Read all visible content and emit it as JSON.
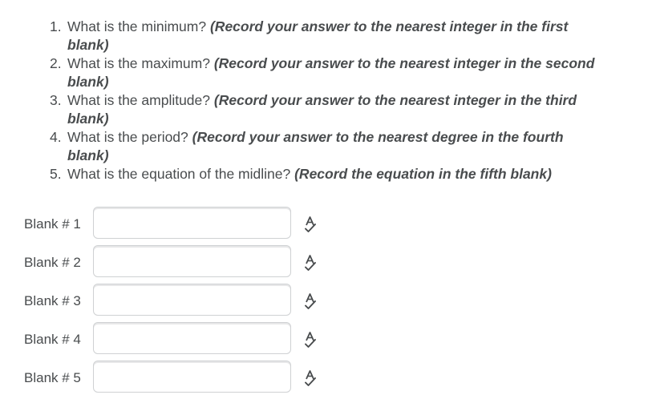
{
  "questions": [
    {
      "number": "1.",
      "text": "What is the minimum?",
      "note": "(Record your answer to the nearest integer in the first blank)"
    },
    {
      "number": "2.",
      "text": "What is the maximum?",
      "note": "(Record your answer to the nearest integer in the second blank)"
    },
    {
      "number": "3.",
      "text": "What is the amplitude?",
      "note": "(Record your answer to the nearest integer in the third blank)"
    },
    {
      "number": "4.",
      "text": "What is the period?",
      "note": "(Record your answer to the nearest degree in the fourth blank)"
    },
    {
      "number": "5.",
      "text": "What is the equation of the midline?",
      "note": "(Record the equation in the fifth blank)"
    }
  ],
  "blanks": [
    {
      "label": "Blank # 1",
      "value": "",
      "icon": "spellcheck-icon"
    },
    {
      "label": "Blank # 2",
      "value": "",
      "icon": "spellcheck-icon"
    },
    {
      "label": "Blank # 3",
      "value": "",
      "icon": "spellcheck-icon"
    },
    {
      "label": "Blank # 4",
      "value": "",
      "icon": "spellcheck-icon"
    },
    {
      "label": "Blank # 5",
      "value": "",
      "icon": "spellcheck-icon"
    }
  ],
  "colors": {
    "text": "#494c4e",
    "input_border": "#cfd1d3"
  }
}
